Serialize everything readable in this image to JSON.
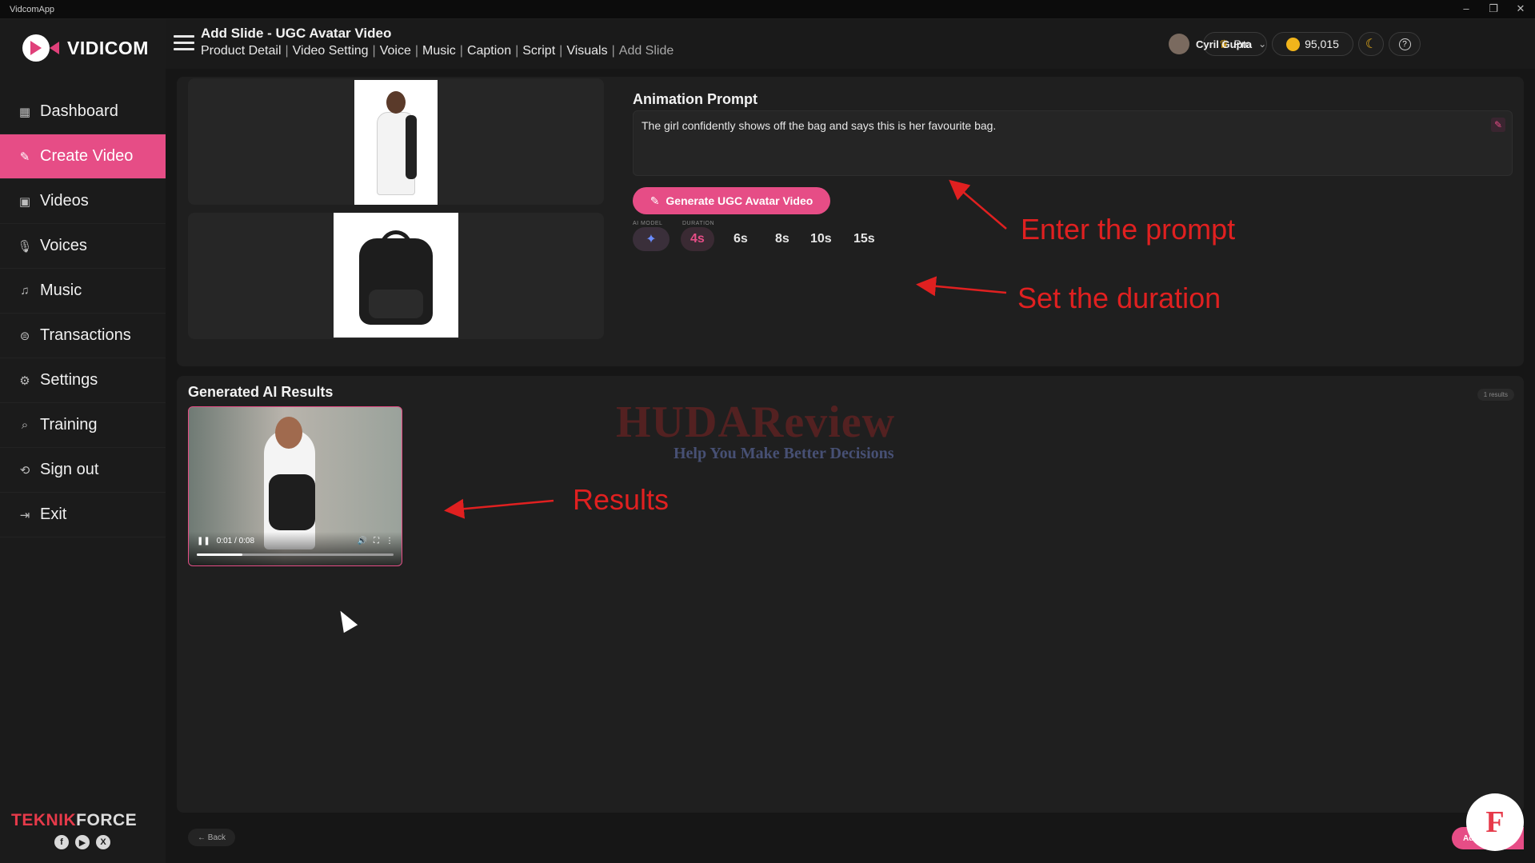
{
  "window": {
    "app_name": "VidcomApp",
    "minimize": "–",
    "restore": "❐",
    "close": "✕"
  },
  "brand": {
    "logo_word": "VIDICOM",
    "footer_name_1": "TEKNIK",
    "footer_name_2": "FORCE",
    "socials": [
      "f",
      "▶",
      "X"
    ]
  },
  "sidebar": {
    "items": [
      {
        "label": "Dashboard",
        "icon": "dashboard-icon"
      },
      {
        "label": "Create Video",
        "icon": "create-video-icon",
        "active": true
      },
      {
        "label": "Videos",
        "icon": "videos-icon"
      },
      {
        "label": "Voices",
        "icon": "microphone-icon"
      },
      {
        "label": "Music",
        "icon": "music-icon"
      },
      {
        "label": "Transactions",
        "icon": "transactions-icon"
      },
      {
        "label": "Settings",
        "icon": "gear-icon"
      },
      {
        "label": "Training",
        "icon": "training-icon"
      },
      {
        "label": "Sign out",
        "icon": "sign-out-icon"
      },
      {
        "label": "Exit",
        "icon": "exit-icon"
      }
    ]
  },
  "header": {
    "title": "Add Slide - UGC Avatar Video",
    "breadcrumbs": [
      "Product Detail",
      "Video Setting",
      "Voice",
      "Music",
      "Caption",
      "Script",
      "Visuals",
      "Add Slide"
    ],
    "plan": "Pro",
    "credits": "95,015",
    "user_name": "Cyril Gupta"
  },
  "animation": {
    "title": "Animation Prompt",
    "prompt_value": "The girl confidently shows off the bag and says this is her favourite bag.",
    "generate_label": "Generate UGC Avatar Video",
    "ai_model_label": "AI MODEL",
    "duration_label": "DURATION",
    "durations": [
      "4s",
      "6s",
      "8s",
      "10s",
      "15s"
    ],
    "selected_duration": "4s"
  },
  "results": {
    "title": "Generated AI Results",
    "count": "1 results",
    "video_time": "0:01 / 0:08",
    "progress_fraction": 0.23
  },
  "watermark": {
    "line1": "HUDAReview",
    "line2": "Help You Make Better Decisions"
  },
  "annotations": {
    "prompt_note": "Enter the prompt",
    "duration_note": "Set the duration",
    "results_note": "Results"
  },
  "footer": {
    "back_label": "← Back",
    "add_label": "Add S"
  },
  "colors": {
    "accent": "#e64d86",
    "annotation": "#e02020",
    "background": "#161616"
  }
}
